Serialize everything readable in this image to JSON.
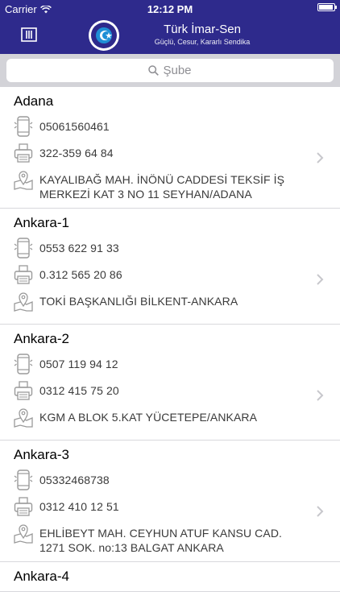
{
  "status": {
    "carrier": "Carrier",
    "time": "12:12 PM",
    "battery_level": 0.95
  },
  "header": {
    "title": "Türk İmar-Sen",
    "subtitle": "Güçlü, Cesur, Kararlı Sendika"
  },
  "search": {
    "placeholder": "Şube"
  },
  "colors": {
    "brand": "#2e2a8c",
    "search_bg": "#d3d3d8"
  },
  "branches": [
    {
      "name": "Adana",
      "phone": "05061560461",
      "fax": "322-359 64 84",
      "address": "KAYALIBAĞ MAH. İNÖNÜ CADDESİ TEKSİF İŞ MERKEZİ KAT 3 NO 11 SEYHAN/ADANA"
    },
    {
      "name": "Ankara-1",
      "phone": "0553 622 91 33",
      "fax": "0.312 565 20 86",
      "address": "TOKİ BAŞKANLIĞI BİLKENT-ANKARA"
    },
    {
      "name": "Ankara-2",
      "phone": "0507 119 94 12",
      "fax": "0312 415 75 20",
      "address": "KGM A BLOK 5.KAT YÜCETEPE/ANKARA"
    },
    {
      "name": "Ankara-3",
      "phone": "05332468738",
      "fax": "0312 410 12 51",
      "address": "EHLİBEYT MAH. CEYHUN ATUF KANSU CAD. 1271 SOK. no:13 BALGAT ANKARA"
    },
    {
      "name": "Ankara-4"
    }
  ]
}
